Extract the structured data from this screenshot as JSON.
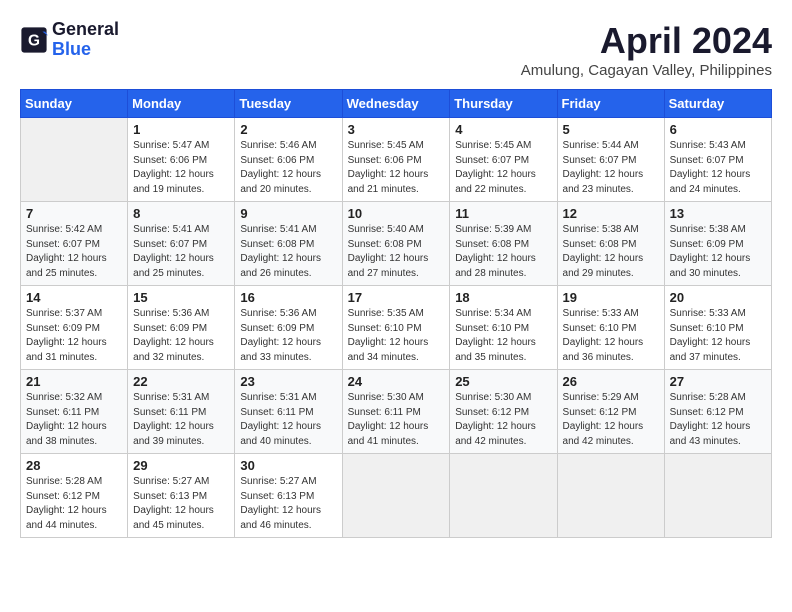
{
  "logo": {
    "line1": "General",
    "line2": "Blue"
  },
  "title": "April 2024",
  "location": "Amulung, Cagayan Valley, Philippines",
  "weekdays": [
    "Sunday",
    "Monday",
    "Tuesday",
    "Wednesday",
    "Thursday",
    "Friday",
    "Saturday"
  ],
  "weeks": [
    [
      {
        "day": "",
        "info": ""
      },
      {
        "day": "1",
        "info": "Sunrise: 5:47 AM\nSunset: 6:06 PM\nDaylight: 12 hours\nand 19 minutes."
      },
      {
        "day": "2",
        "info": "Sunrise: 5:46 AM\nSunset: 6:06 PM\nDaylight: 12 hours\nand 20 minutes."
      },
      {
        "day": "3",
        "info": "Sunrise: 5:45 AM\nSunset: 6:06 PM\nDaylight: 12 hours\nand 21 minutes."
      },
      {
        "day": "4",
        "info": "Sunrise: 5:45 AM\nSunset: 6:07 PM\nDaylight: 12 hours\nand 22 minutes."
      },
      {
        "day": "5",
        "info": "Sunrise: 5:44 AM\nSunset: 6:07 PM\nDaylight: 12 hours\nand 23 minutes."
      },
      {
        "day": "6",
        "info": "Sunrise: 5:43 AM\nSunset: 6:07 PM\nDaylight: 12 hours\nand 24 minutes."
      }
    ],
    [
      {
        "day": "7",
        "info": "Sunrise: 5:42 AM\nSunset: 6:07 PM\nDaylight: 12 hours\nand 25 minutes."
      },
      {
        "day": "8",
        "info": "Sunrise: 5:41 AM\nSunset: 6:07 PM\nDaylight: 12 hours\nand 25 minutes."
      },
      {
        "day": "9",
        "info": "Sunrise: 5:41 AM\nSunset: 6:08 PM\nDaylight: 12 hours\nand 26 minutes."
      },
      {
        "day": "10",
        "info": "Sunrise: 5:40 AM\nSunset: 6:08 PM\nDaylight: 12 hours\nand 27 minutes."
      },
      {
        "day": "11",
        "info": "Sunrise: 5:39 AM\nSunset: 6:08 PM\nDaylight: 12 hours\nand 28 minutes."
      },
      {
        "day": "12",
        "info": "Sunrise: 5:38 AM\nSunset: 6:08 PM\nDaylight: 12 hours\nand 29 minutes."
      },
      {
        "day": "13",
        "info": "Sunrise: 5:38 AM\nSunset: 6:09 PM\nDaylight: 12 hours\nand 30 minutes."
      }
    ],
    [
      {
        "day": "14",
        "info": "Sunrise: 5:37 AM\nSunset: 6:09 PM\nDaylight: 12 hours\nand 31 minutes."
      },
      {
        "day": "15",
        "info": "Sunrise: 5:36 AM\nSunset: 6:09 PM\nDaylight: 12 hours\nand 32 minutes."
      },
      {
        "day": "16",
        "info": "Sunrise: 5:36 AM\nSunset: 6:09 PM\nDaylight: 12 hours\nand 33 minutes."
      },
      {
        "day": "17",
        "info": "Sunrise: 5:35 AM\nSunset: 6:10 PM\nDaylight: 12 hours\nand 34 minutes."
      },
      {
        "day": "18",
        "info": "Sunrise: 5:34 AM\nSunset: 6:10 PM\nDaylight: 12 hours\nand 35 minutes."
      },
      {
        "day": "19",
        "info": "Sunrise: 5:33 AM\nSunset: 6:10 PM\nDaylight: 12 hours\nand 36 minutes."
      },
      {
        "day": "20",
        "info": "Sunrise: 5:33 AM\nSunset: 6:10 PM\nDaylight: 12 hours\nand 37 minutes."
      }
    ],
    [
      {
        "day": "21",
        "info": "Sunrise: 5:32 AM\nSunset: 6:11 PM\nDaylight: 12 hours\nand 38 minutes."
      },
      {
        "day": "22",
        "info": "Sunrise: 5:31 AM\nSunset: 6:11 PM\nDaylight: 12 hours\nand 39 minutes."
      },
      {
        "day": "23",
        "info": "Sunrise: 5:31 AM\nSunset: 6:11 PM\nDaylight: 12 hours\nand 40 minutes."
      },
      {
        "day": "24",
        "info": "Sunrise: 5:30 AM\nSunset: 6:11 PM\nDaylight: 12 hours\nand 41 minutes."
      },
      {
        "day": "25",
        "info": "Sunrise: 5:30 AM\nSunset: 6:12 PM\nDaylight: 12 hours\nand 42 minutes."
      },
      {
        "day": "26",
        "info": "Sunrise: 5:29 AM\nSunset: 6:12 PM\nDaylight: 12 hours\nand 42 minutes."
      },
      {
        "day": "27",
        "info": "Sunrise: 5:28 AM\nSunset: 6:12 PM\nDaylight: 12 hours\nand 43 minutes."
      }
    ],
    [
      {
        "day": "28",
        "info": "Sunrise: 5:28 AM\nSunset: 6:12 PM\nDaylight: 12 hours\nand 44 minutes."
      },
      {
        "day": "29",
        "info": "Sunrise: 5:27 AM\nSunset: 6:13 PM\nDaylight: 12 hours\nand 45 minutes."
      },
      {
        "day": "30",
        "info": "Sunrise: 5:27 AM\nSunset: 6:13 PM\nDaylight: 12 hours\nand 46 minutes."
      },
      {
        "day": "",
        "info": ""
      },
      {
        "day": "",
        "info": ""
      },
      {
        "day": "",
        "info": ""
      },
      {
        "day": "",
        "info": ""
      }
    ]
  ]
}
